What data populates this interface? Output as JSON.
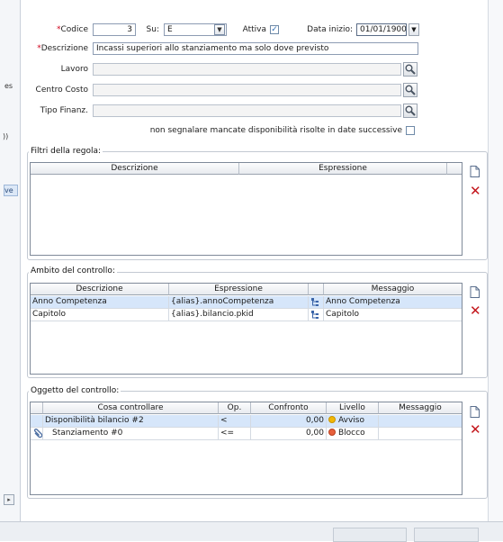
{
  "form": {
    "codice_label": "Codice",
    "codice_value": "3",
    "su_label": "Su:",
    "su_value": "E",
    "attiva_label": "Attiva",
    "attiva_checked": true,
    "data_inizio_label": "Data inizio:",
    "data_inizio_value": "01/01/1900",
    "descrizione_label": "Descrizione",
    "descrizione_value": "Incassi superiori allo stanziamento ma solo dove previsto",
    "lavoro_label": "Lavoro",
    "centro_costo_label": "Centro Costo",
    "tipo_finanz_label": "Tipo Finanz.",
    "non_segnalare_label": "non segnalare mancate disponibilità risolte in date successive",
    "non_segnalare_checked": false
  },
  "left_strip": {
    "text1": "es",
    "text2": "))",
    "tag": "ve"
  },
  "filtri": {
    "title": "Filtri della regola:",
    "columns": [
      "Descrizione",
      "Espressione"
    ]
  },
  "ambito": {
    "title": "Ambito del controllo:",
    "columns": [
      "Descrizione",
      "Espressione",
      "",
      "Messaggio"
    ],
    "rows": [
      {
        "descrizione": "Anno Competenza",
        "espressione": "{alias}.annoCompetenza",
        "messaggio": "Anno Competenza",
        "selected": true
      },
      {
        "descrizione": "Capitolo",
        "espressione": "{alias}.bilancio.pkid",
        "messaggio": "Capitolo",
        "selected": false
      }
    ]
  },
  "oggetto": {
    "title": "Oggetto del controllo:",
    "columns": [
      "Cosa controllare",
      "Op.",
      "Confronto",
      "Livello",
      "Messaggio"
    ],
    "rows": [
      {
        "cosa": "Disponibilità bilancio #2",
        "op": "<",
        "confronto": "0,00",
        "livello": "Avviso",
        "livello_color": "#f2b705",
        "messaggio": "",
        "selected": true,
        "attachment": false
      },
      {
        "cosa": "Stanziamento #0",
        "op": "<=",
        "confronto": "0,00",
        "livello": "Blocco",
        "livello_color": "#e8603c",
        "messaggio": "",
        "selected": false,
        "attachment": true
      }
    ]
  },
  "icons": {
    "required_marker": "*",
    "new": "new-document-icon",
    "delete": "delete-x-icon",
    "lookup": "magnifier-icon",
    "dropdown": "chevron-down-icon",
    "tree": "tree-structure-icon",
    "attachment": "paperclip-icon"
  },
  "colors": {
    "selected_row": "#d6e6fa",
    "required": "#d0021b",
    "delete": "#c4161c"
  }
}
